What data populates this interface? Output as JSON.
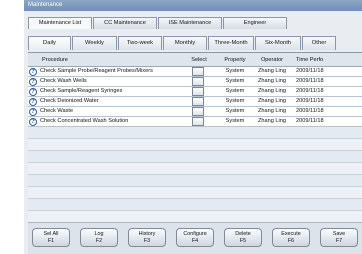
{
  "window": {
    "title": "Maintenance"
  },
  "tabs_top": [
    {
      "label": "Maintenance List"
    },
    {
      "label": "CC Maintenance"
    },
    {
      "label": "ISE Maintenance"
    },
    {
      "label": "Engineer"
    }
  ],
  "tabs_sub": [
    {
      "label": "Daily"
    },
    {
      "label": "Weekly"
    },
    {
      "label": "Two-week"
    },
    {
      "label": "Monthly"
    },
    {
      "label": "Three-Month"
    },
    {
      "label": "Six-Month"
    },
    {
      "label": "Other"
    }
  ],
  "table": {
    "headers": {
      "procedure": "Procedure",
      "select": "Select",
      "property": "Property",
      "operator": "Operator",
      "time": "Time Perfo"
    },
    "rows": [
      {
        "procedure": "Check Sample Probe/Reagent Probes/Mixers",
        "property": "System",
        "operator": "Zhang Ling",
        "time": "2009/11/18"
      },
      {
        "procedure": "Check Wash Wells",
        "property": "System",
        "operator": "Zhang Ling",
        "time": "2009/11/18"
      },
      {
        "procedure": "Check Sample/Reagent Syringes",
        "property": "System",
        "operator": "Zhang Ling",
        "time": "2009/11/18"
      },
      {
        "procedure": "Check Deionized Water",
        "property": "System",
        "operator": "Zhang Ling",
        "time": "2009/11/18"
      },
      {
        "procedure": "Check Waste",
        "property": "System",
        "operator": "Zhang Ling",
        "time": "2009/11/18"
      },
      {
        "procedure": "Check Concentrated Wash Solution",
        "property": "System",
        "operator": "Zhang Ling",
        "time": "2009/11/18"
      }
    ]
  },
  "buttons": [
    {
      "label": "Sel All",
      "key": "F1"
    },
    {
      "label": "Log",
      "key": "F2"
    },
    {
      "label": "History",
      "key": "F3"
    },
    {
      "label": "Configure",
      "key": "F4"
    },
    {
      "label": "Delete",
      "key": "F5"
    },
    {
      "label": "Execute",
      "key": "F6"
    },
    {
      "label": "Save",
      "key": "F7"
    }
  ]
}
